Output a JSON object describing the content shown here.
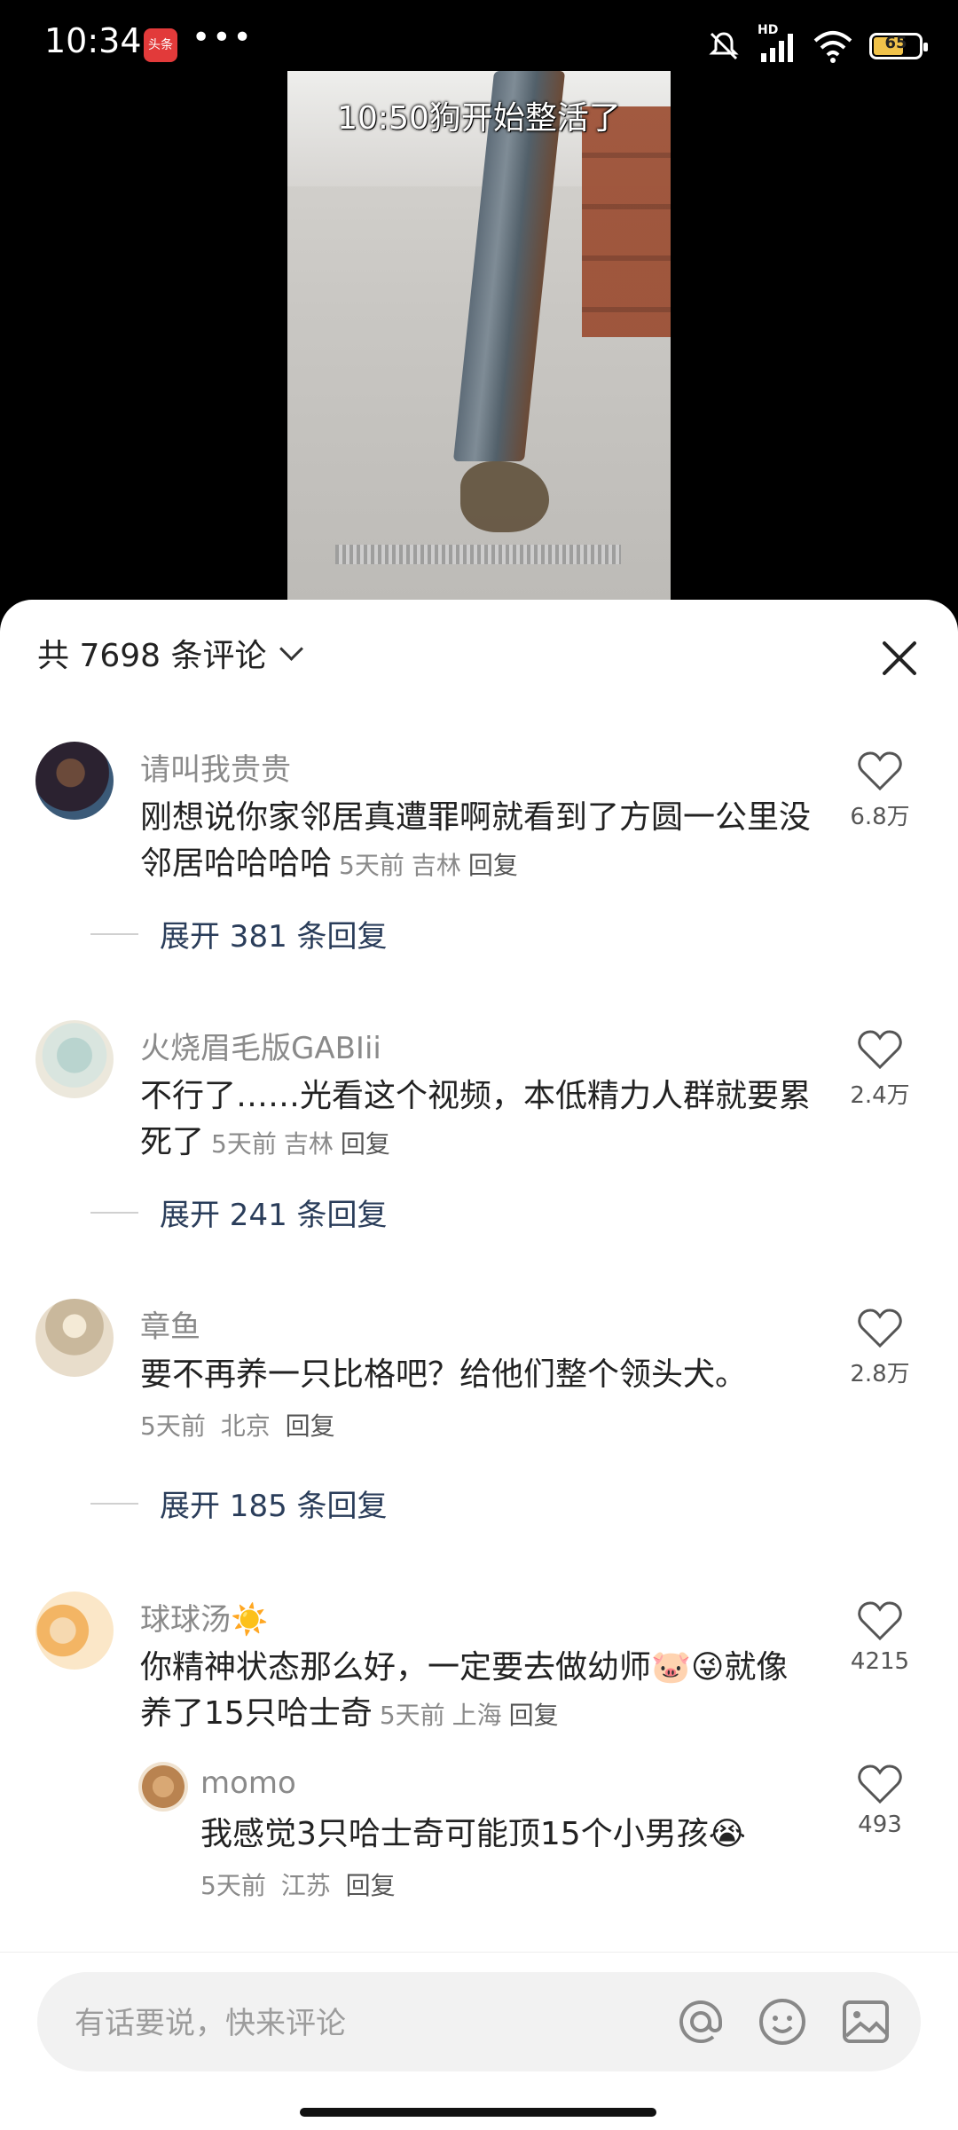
{
  "status": {
    "time": "10:34",
    "app_badge": "头条",
    "menu": "•••",
    "network": "HD",
    "battery": "65"
  },
  "video": {
    "caption": "10:50狗开始整活了"
  },
  "comments_header": {
    "title": "共 7698 条评论"
  },
  "comments": [
    {
      "user": "请叫我贵贵",
      "text": "刚想说你家邻居真遭罪啊就看到了方圆一公里没邻居哈哈哈哈",
      "time": "5天前",
      "location": "吉林",
      "reply": "回复",
      "likes": "6.8万",
      "expand": "展开 381 条回复"
    },
    {
      "user": "火烧眉毛版GABIii",
      "text": "不行了……光看这个视频，本低精力人群就要累死了",
      "time": "5天前",
      "location": "吉林",
      "reply": "回复",
      "likes": "2.4万",
      "expand": "展开 241 条回复"
    },
    {
      "user": "章鱼",
      "text": "要不再养一只比格吧？给他们整个领头犬。",
      "time": "5天前",
      "location": "北京",
      "reply": "回复",
      "likes": "2.8万",
      "expand": "展开 185 条回复"
    },
    {
      "user": "球球汤☀️",
      "text": "你精神状态那么好，一定要去做幼师🐷😜就像养了15只哈士奇",
      "time": "5天前",
      "location": "上海",
      "reply": "回复",
      "likes": "4215"
    }
  ],
  "reply": {
    "user": "momo",
    "text": "我感觉3只哈士奇可能顶15个小男孩😭",
    "time": "5天前",
    "location": "江苏",
    "reply": "回复",
    "likes": "493"
  },
  "input": {
    "placeholder": "有话要说，快来评论"
  },
  "colors": {
    "accent_link": "#2a3d5a",
    "meta_gray": "#8a8a8a"
  }
}
